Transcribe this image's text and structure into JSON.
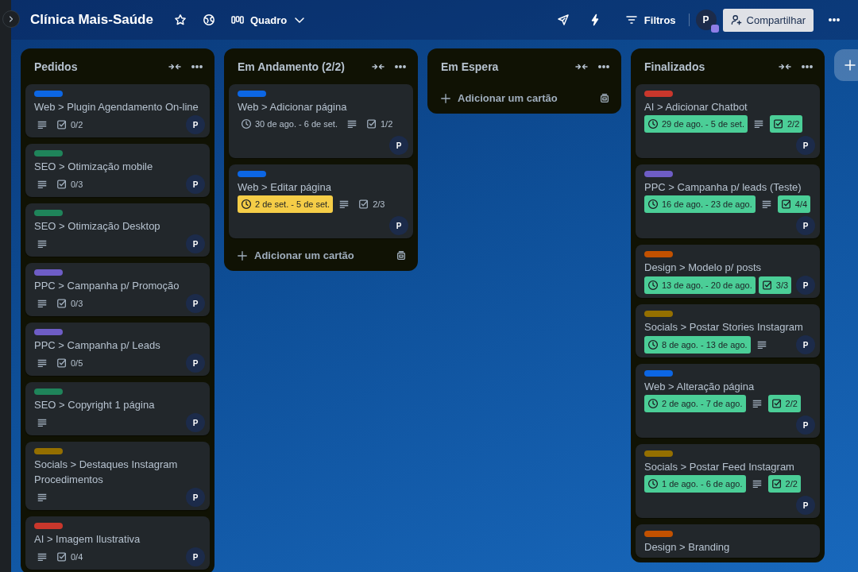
{
  "board": {
    "title": "Clínica Mais-Saúde",
    "view": "Quadro",
    "filter": "Filtros",
    "member": "P",
    "share": "Compartilhar"
  },
  "lists": [
    {
      "title": "Pedidos",
      "cards": [
        {
          "color": "#0c66e4",
          "title": "Web > Plugin Agendamento On-line",
          "description": true,
          "checklist": {
            "text": "0/2",
            "complete": false
          },
          "member": "P"
        },
        {
          "color": "#1f845a",
          "title": "SEO > Otimização mobile",
          "description": true,
          "checklist": {
            "text": "0/3",
            "complete": false
          },
          "member": "P"
        },
        {
          "color": "#1f845a",
          "title": "SEO > Otimização Desktop",
          "description": true,
          "member": "P"
        },
        {
          "color": "#6e5dc6",
          "title": "PPC > Campanha p/ Promoção",
          "description": true,
          "checklist": {
            "text": "0/3",
            "complete": false
          },
          "member": "P"
        },
        {
          "color": "#6e5dc6",
          "title": "PPC > Campanha p/ Leads",
          "description": true,
          "checklist": {
            "text": "0/5",
            "complete": false
          },
          "member": "P"
        },
        {
          "color": "#1f845a",
          "title": "SEO > Copyright 1 página",
          "description": true,
          "member": "P"
        },
        {
          "color": "#946f00",
          "title": "Socials > Destaques Instagram Procedimentos",
          "description": true,
          "member": "P"
        },
        {
          "color": "#c9372c",
          "title": "AI > Imagem Ilustrativa",
          "description": true,
          "checklist": {
            "text": "0/4",
            "complete": false
          },
          "member": "P"
        }
      ]
    },
    {
      "title": "Em Andamento (2/2)",
      "cards": [
        {
          "color": "#0c66e4",
          "title": "Web > Adicionar página",
          "dates": {
            "text": "30 de ago. - 6 de set.",
            "kind": "none"
          },
          "description": true,
          "checklist": {
            "text": "1/2",
            "complete": false
          },
          "member": "P"
        },
        {
          "color": "#0c66e4",
          "title": "Web > Editar página",
          "dates": {
            "text": "2 de set. - 5 de set.",
            "kind": "due_soon"
          },
          "description": true,
          "checklist": {
            "text": "2/3",
            "complete": false
          },
          "member": "P"
        }
      ],
      "add_card": "Adicionar um cartão"
    },
    {
      "title": "Em Espera",
      "add_card": "Adicionar um cartão"
    },
    {
      "title": "Finalizados",
      "cards": [
        {
          "color": "#c9372c",
          "title": "AI > Adicionar Chatbot",
          "dates": {
            "text": "29 de ago. - 5 de set.",
            "kind": "complete"
          },
          "description": true,
          "checklist": {
            "text": "2/2",
            "complete": true
          },
          "member": "P"
        },
        {
          "color": "#6e5dc6",
          "title": "PPC > Campanha p/ leads (Teste)",
          "dates": {
            "text": "16 de ago. - 23 de ago.",
            "kind": "complete"
          },
          "description": true,
          "checklist": {
            "text": "4/4",
            "complete": true
          },
          "member": "P"
        },
        {
          "color": "#c25100",
          "title": "Design > Modelo p/ posts",
          "dates": {
            "text": "13 de ago. - 20 de ago.",
            "kind": "complete"
          },
          "description": false,
          "checklist": {
            "text": "3/3",
            "complete": true
          },
          "member": "P"
        },
        {
          "color": "#946f00",
          "title": "Socials > Postar Stories Instagram",
          "dates": {
            "text": "8 de ago. - 13 de ago.",
            "kind": "complete"
          },
          "description": true,
          "member": "P"
        },
        {
          "color": "#0c66e4",
          "title": "Web > Alteração página",
          "dates": {
            "text": "2 de ago. - 7 de ago.",
            "kind": "complete"
          },
          "description": true,
          "checklist": {
            "text": "2/2",
            "complete": true
          },
          "member": "P"
        },
        {
          "color": "#946f00",
          "title": "Socials > Postar Feed Instagram",
          "dates": {
            "text": "1 de ago. - 6 de ago.",
            "kind": "complete"
          },
          "description": true,
          "checklist": {
            "text": "2/2",
            "complete": true
          },
          "member": "P"
        },
        {
          "color": "#c25100",
          "title": "Design > Branding"
        }
      ]
    }
  ]
}
